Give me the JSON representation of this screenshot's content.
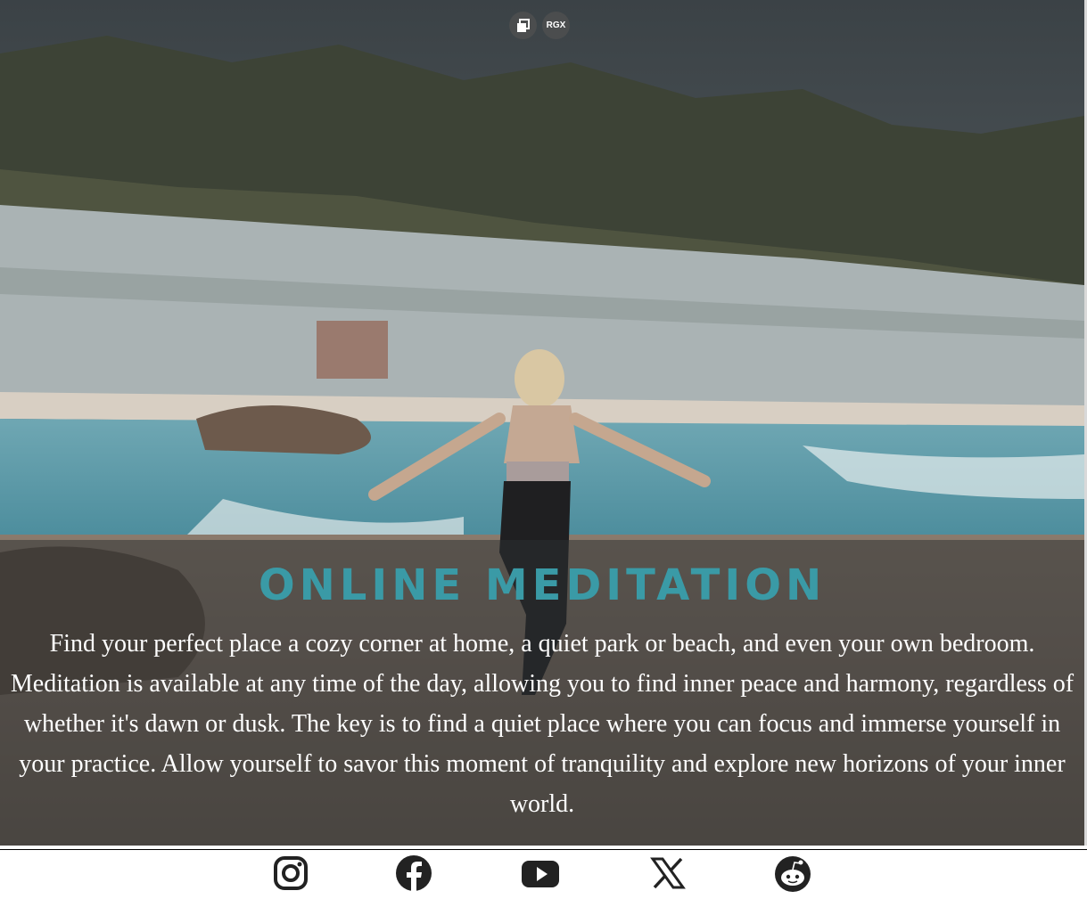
{
  "top_icons": {
    "copy_icon": "copy-icon",
    "rgx_label": "RGX"
  },
  "hero": {
    "title": "ONLINE MEDITATION",
    "description": "Find your perfect place a cozy corner at home, a quiet park or beach, and even your own bedroom. Meditation is available at any time of the day, allowing you to find inner peace and harmony, regardless of whether it's dawn or dusk. The key is to find a quiet place where you can focus and immerse yourself in your practice. Allow yourself to savor this moment of tranquility and explore new horizons of your inner world.",
    "title_color": "#3a9aa6"
  },
  "social": [
    {
      "icon": "instagram-icon"
    },
    {
      "icon": "facebook-icon"
    },
    {
      "icon": "youtube-icon"
    },
    {
      "icon": "x-icon"
    },
    {
      "icon": "reddit-icon"
    }
  ]
}
